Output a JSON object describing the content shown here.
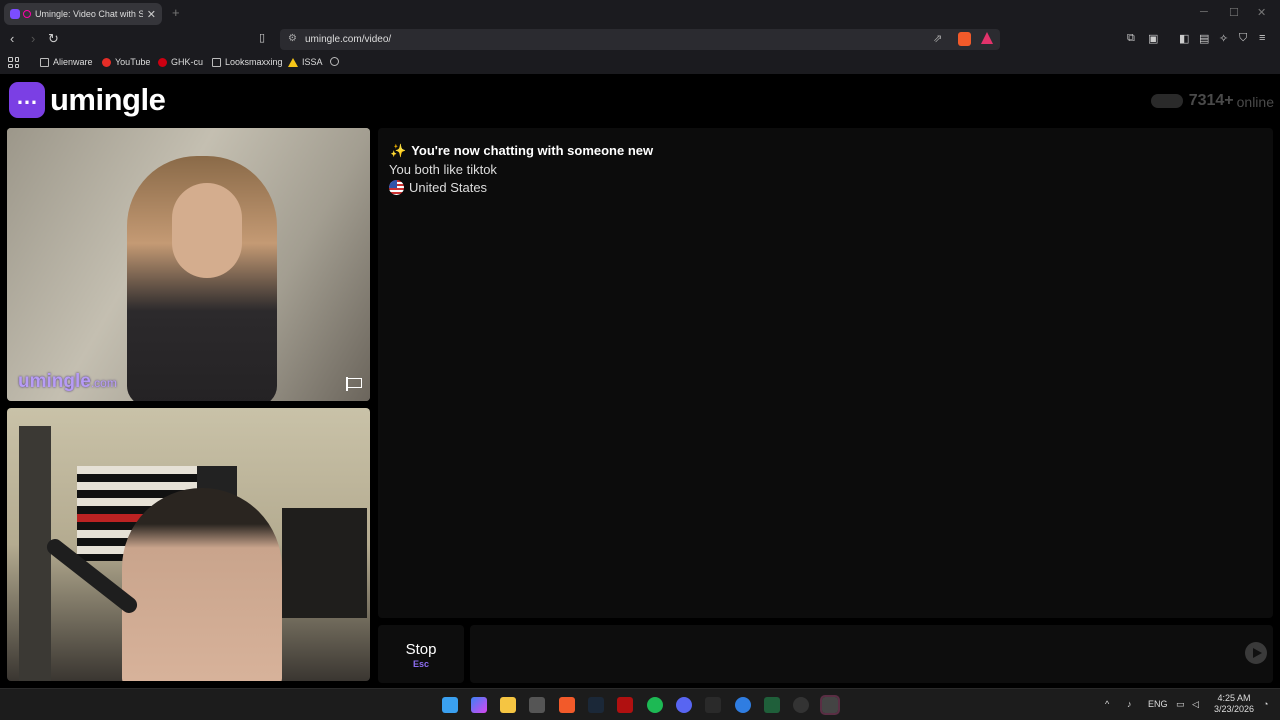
{
  "browser": {
    "tab_title": "Umingle: Video Chat with Str",
    "url": "umingle.com/video/",
    "bookmarks": [
      "Alienware",
      "YouTube",
      "GHK-cu",
      "Looksmaxxing",
      "ISSA"
    ]
  },
  "header": {
    "logo_text": "umingle",
    "online_count": "7314+",
    "online_label": "online"
  },
  "stranger_video": {
    "watermark": "umingle",
    "watermark_suffix": ".com"
  },
  "chat": {
    "spark": "✨",
    "status": "You're now chatting with someone new",
    "common_interest": "You both like tiktok",
    "country": "United States"
  },
  "controls": {
    "stop_label": "Stop",
    "stop_shortcut": "Esc",
    "message_value": ""
  },
  "taskbar": {
    "lang": "ENG",
    "time": "4:25 AM",
    "date": "3/23/2026"
  },
  "icons": [
    "umingle-logo-icon",
    "flag-report-icon",
    "send-icon",
    "us-flag-icon",
    "back-icon",
    "forward-icon",
    "reload-icon",
    "bookmark-icon",
    "share-icon"
  ],
  "colors": {
    "brand": "#7b3fe4",
    "watermark": "#b79cf5",
    "shortcut": "#8c6df0"
  }
}
